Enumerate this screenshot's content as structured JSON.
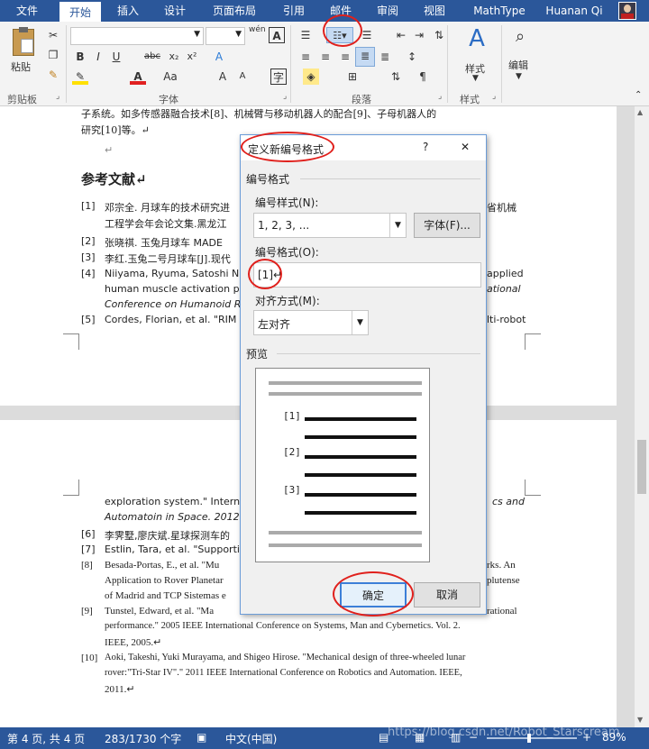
{
  "tabs": {
    "file": "文件",
    "home": "开始",
    "insert": "插入",
    "design": "设计",
    "layout": "页面布局",
    "references": "引用",
    "mailings": "邮件",
    "review": "审阅",
    "view": "视图",
    "mathtype": "MathType",
    "user": "Huanan Qi"
  },
  "ribbon": {
    "paste": "粘贴",
    "clipboard": "剪贴板",
    "font": "字体",
    "paragraph": "段落",
    "styles_label": "样式",
    "styles_group": "样式",
    "editing": "编辑",
    "wen": "wén",
    "aa": "Aa",
    "font_a": "A"
  },
  "doc": {
    "intro_line": "子系统。如多传感器融合技术[8]、机械臂与移动机器人的配合[9]、子母机器人的",
    "intro_line2": "研究[10]等。↵",
    "heading": "参考文献↵",
    "refs": [
      {
        "n": "[1]",
        "l1": "邓宗全. 月球车的技术研究进",
        "l1r": "省机械",
        "l2": "工程学会年会论文集.黑龙江"
      },
      {
        "n": "[2]",
        "l1": "张晓祺. 玉兔月球车 MADE"
      },
      {
        "n": "[3]",
        "l1": "李红.玉兔二号月球车[J].现代"
      },
      {
        "n": "[4]",
        "l1": "Niiyama, Ryuma, Satoshi Ni",
        "l1r": "applied",
        "l2": "human muscle activation patt",
        "l2r": "ational",
        "l3": "Conference on Humanoid Ro"
      },
      {
        "n": "[5]",
        "l1": "Cordes, Florian, et al. \"RIM",
        "l1r": "lti-robot"
      }
    ],
    "p2_l1a": "exploration system.\" Internat",
    "p2_l1b": "cs and",
    "p2_l2": "Automatoin in Space. 2012.↵",
    "refs2": [
      {
        "n": "[6]",
        "l1": "李霁墅,廖庆斌.星球探测车的"
      },
      {
        "n": "[7]",
        "l1": "Estlin, Tara, et al. \"Supporting"
      },
      {
        "n": "[8]",
        "l1": "Besada-Portas, E., et al. \"Mu",
        "l1r": "rks. An",
        "l2": "Application to Rover Planetar",
        "l2r": "plutense",
        "l3": "of Madrid and TCP Sistemas e"
      },
      {
        "n": "[9]",
        "l1": "Tunstel, Edward, et al. \"Ma",
        "l1r": "rational",
        "l2": "performance.\" 2005 IEEE International Conference on Systems, Man and Cybernetics. Vol. 2.",
        "l3": "IEEE, 2005.↵"
      },
      {
        "n": "[10]",
        "l1": "Aoki, Takeshi, Yuki Murayama, and Shigeo Hirose. \"Mechanical design of three-wheeled lunar",
        "l2": "rover:\"Tri-Star IV\".\" 2011 IEEE International Conference on Robotics and Automation. IEEE,",
        "l3": "2011.↵"
      }
    ],
    "mark": "↵"
  },
  "dialog": {
    "title": "定义新编号格式",
    "help": "?",
    "close": "✕",
    "section": "编号格式",
    "style_label": "编号样式(N):",
    "style_value": "1, 2, 3, ...",
    "font_button": "字体(F)...",
    "format_label": "编号格式(O):",
    "format_value": "[1]↵",
    "align_label": "对齐方式(M):",
    "align_value": "左对齐",
    "preview_label": "预览",
    "preview_items": [
      "[1]",
      "[2]",
      "[3]"
    ],
    "ok": "确定",
    "cancel": "取消"
  },
  "status": {
    "page": "第 4 页, 共 4 页",
    "words": "283/1730 个字",
    "lang": "中文(中国)",
    "zoom": "89%",
    "watermark": "https://blog.csdn.net/Robot_Starscream"
  }
}
